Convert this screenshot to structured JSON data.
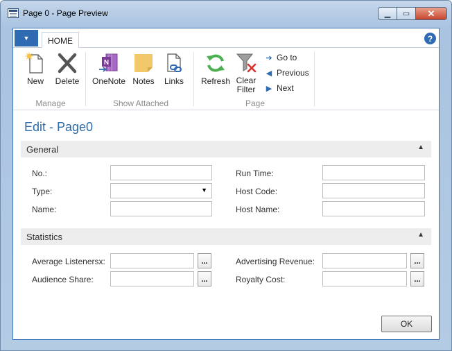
{
  "window": {
    "title": "Page 0 - Page Preview",
    "controls": {
      "minimize": "▁",
      "maximize": "▭",
      "close": "✕"
    }
  },
  "ribbon": {
    "menu_button_glyph": "▼",
    "tab": "HOME",
    "help_glyph": "?",
    "groups": [
      {
        "label": "Manage",
        "buttons": [
          "New",
          "Delete"
        ]
      },
      {
        "label": "Show Attached",
        "buttons": [
          "OneNote",
          "Notes",
          "Links"
        ]
      },
      {
        "label": "Page",
        "buttons": [
          "Refresh",
          "Clear Filter"
        ],
        "small_buttons": [
          "Go to",
          "Previous",
          "Next"
        ]
      }
    ]
  },
  "form": {
    "title": "Edit - Page0",
    "sections": [
      {
        "title": "General",
        "collapse_glyph": "▲",
        "fields_left": [
          {
            "label": "No.:",
            "value": ""
          },
          {
            "label": "Type:",
            "value": "",
            "type": "dropdown",
            "arrow": "▼"
          },
          {
            "label": "Name:",
            "value": ""
          }
        ],
        "fields_right": [
          {
            "label": "Run Time:",
            "value": ""
          },
          {
            "label": "Host Code:",
            "value": ""
          },
          {
            "label": "Host Name:",
            "value": ""
          }
        ]
      },
      {
        "title": "Statistics",
        "collapse_glyph": "▲",
        "ellipsis": "...",
        "fields_left": [
          {
            "label": "Average Listenersx:",
            "value": ""
          },
          {
            "label": "Audience Share:",
            "value": ""
          }
        ],
        "fields_right": [
          {
            "label": "Advertising Revenue:",
            "value": ""
          },
          {
            "label": "Royalty Cost:",
            "value": ""
          }
        ]
      }
    ],
    "ok_label": "OK"
  },
  "colors": {
    "accent": "#2f6bb2",
    "title_blue": "#2d6ca8",
    "section_bg": "#ededed",
    "onenote_purple": "#7a3a96",
    "notes_yellow": "#f2c86b",
    "refresh_green": "#4caf50",
    "delete_gray": "#555555",
    "filter_red": "#d9302c"
  }
}
